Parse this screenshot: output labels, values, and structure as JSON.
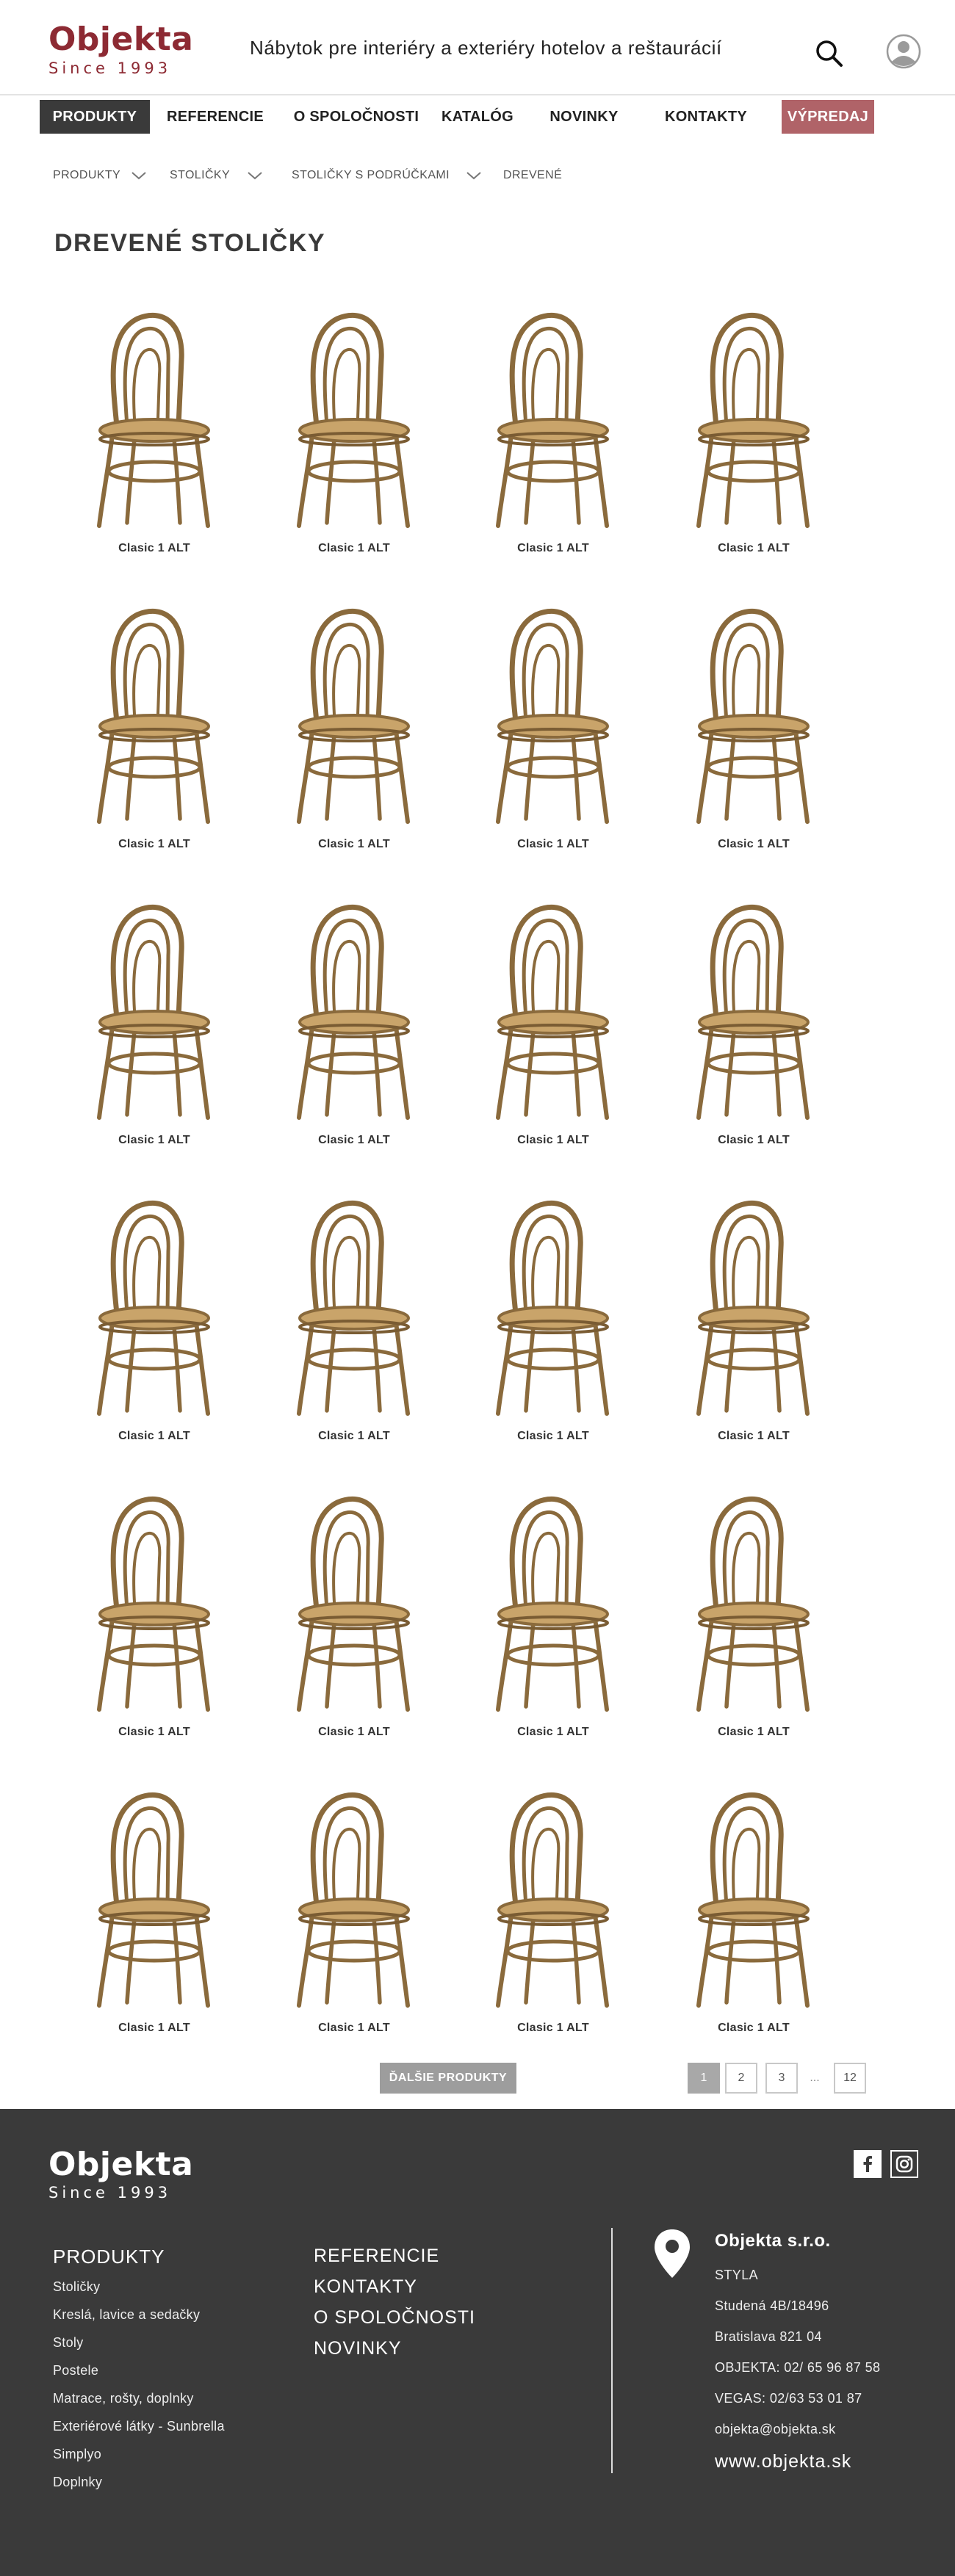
{
  "header": {
    "logo_name": "Objekta",
    "logo_since": "Since 1993",
    "tagline": "Nábytok pre interiéry a exteriéry hotelov a reštaurácií"
  },
  "nav": {
    "items": [
      "PRODUKTY",
      "REFERENCIE",
      "O SPOLOČNOSTI",
      "KATALÓG",
      "NOVINKY",
      "KONTAKTY",
      "VÝPREDAJ"
    ],
    "active": "PRODUKTY",
    "sale_color": "#b06368",
    "active_color": "#3a3a3a"
  },
  "breadcrumb": [
    "PRODUKTY",
    "STOLIČKY",
    "STOLIČKY S PODRÚČKAMI",
    "DREVENÉ"
  ],
  "page_title": "DREVENÉ STOLIČKY",
  "products": [
    "Clasic 1 ALT",
    "Clasic 1 ALT",
    "Clasic 1 ALT",
    "Clasic 1 ALT",
    "Clasic 1 ALT",
    "Clasic 1 ALT",
    "Clasic 1 ALT",
    "Clasic 1 ALT",
    "Clasic 1 ALT",
    "Clasic 1 ALT",
    "Clasic 1 ALT",
    "Clasic 1 ALT",
    "Clasic 1 ALT",
    "Clasic 1 ALT",
    "Clasic 1 ALT",
    "Clasic 1 ALT",
    "Clasic 1 ALT",
    "Clasic 1 ALT",
    "Clasic 1 ALT",
    "Clasic 1 ALT",
    "Clasic 1 ALT",
    "Clasic 1 ALT",
    "Clasic 1 ALT",
    "Clasic 1 ALT"
  ],
  "pagination": {
    "more_label": "ĎALŠIE PRODUKTY",
    "pages": [
      "1",
      "2",
      "3",
      "12"
    ],
    "ellipsis": "...",
    "current": "1"
  },
  "footer": {
    "logo_name": "Objekta",
    "logo_since": "Since 1993",
    "products_title": "PRODUKTY",
    "product_links": [
      "Stoličky",
      "Kreslá, lavice a sedačky",
      "Stoly",
      "Postele",
      "Matrace, rošty, doplnky",
      "Exteriérové látky - Sunbrella",
      "Simplyo",
      "Doplnky"
    ],
    "menu": [
      "REFERENCIE",
      "KONTAKTY",
      "O SPOLOČNOSTI",
      "NOVINKY"
    ],
    "company": "Objekta s.r.o.",
    "contact_lines": [
      "STYLA",
      "Studená 4B/18496",
      "Bratislava 821 04",
      "OBJEKTA: 02/ 65 96 87 58",
      "VEGAS: 02/63 53 01 87",
      "objekta@objekta.sk"
    ],
    "website": "www.objekta.sk",
    "social": [
      "facebook-icon",
      "instagram-icon"
    ]
  },
  "colors": {
    "brand": "#8d2a33",
    "footer_bg": "#3a3a3a",
    "chair_wood": "#8a6a3c",
    "chair_seat": "#c9a46a"
  }
}
